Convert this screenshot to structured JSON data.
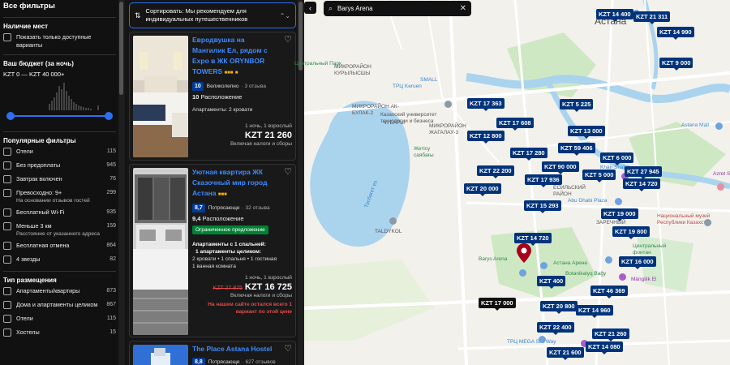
{
  "filters": {
    "title": "Все фильтры",
    "availability": {
      "title": "Наличие мест",
      "items": [
        {
          "label": "Показать только доступные варианты"
        }
      ]
    },
    "budget": {
      "title": "Ваш бюджет (за ночь)",
      "range": "KZT 0 — KZT 40 000+"
    },
    "popular": {
      "title": "Популярные фильтры",
      "items": [
        {
          "label": "Отели",
          "count": "115"
        },
        {
          "label": "Без предоплаты",
          "count": "945"
        },
        {
          "label": "Завтрак включен",
          "count": "76"
        },
        {
          "label": "Превосходно: 9+",
          "sub": "На основании отзывов гостей",
          "count": "299"
        },
        {
          "label": "Бесплатный Wi-Fi",
          "count": "935"
        },
        {
          "label": "Меньше 3 км",
          "sub": "Расстояние от указанного адреса",
          "count": "159"
        },
        {
          "label": "Бесплатная отмена",
          "count": "864"
        },
        {
          "label": "4 звезды",
          "count": "82"
        }
      ]
    },
    "type": {
      "title": "Тип размещения",
      "items": [
        {
          "label": "Апартаменты/квартиры",
          "count": "873"
        },
        {
          "label": "Дома и апартаменты целиком",
          "count": "867"
        },
        {
          "label": "Отели",
          "count": "115"
        },
        {
          "label": "Хостелы",
          "count": "15"
        }
      ]
    }
  },
  "sort": {
    "label": "Сортировать: Мы рекомендуем для индивидуальных путешественников"
  },
  "results": [
    {
      "title": "Евродвушка на Мангилик Ел, рядом с Expo в ЖК ORYNBOR TOWERS",
      "score": "10",
      "score_word": "Великолепно",
      "reviews": "· 3 отзыва",
      "location_score": "10",
      "location_label": "Расположение",
      "unit": "Апартаменты: 2 кровати",
      "nights": "1 ночь, 1 взрослый",
      "price": "KZT 21 260",
      "taxes": "Включая налоги и сборы"
    },
    {
      "title": "Уютная квартира ЖК Сказочный мир город Астана",
      "score": "8,7",
      "score_word": "Потрясающе",
      "reviews": "· 32 отзыва",
      "location_score": "9,4",
      "location_label": "Расположение",
      "deal": "Ограниченное предложение",
      "unit_head": "Апартаменты с 1 спальней:",
      "unit_bold": "1 апартаменты целиком:",
      "unit_line1": "2 кровати • 1 спальня • 1 гостиная",
      "unit_line2": "1 ванная комната",
      "nights": "1 ночь, 1 взрослый",
      "old_price": "KZT 27 875",
      "price": "KZT 16 725",
      "taxes": "Включая налоги и сборы",
      "warning": "На нашем сайте остался всего 1 вариант по этой цене"
    },
    {
      "title": "The Place Astana Hostel",
      "score": "8,8",
      "score_word": "Потрясающе",
      "reviews": "· 627 отзывов"
    }
  ],
  "map": {
    "search_value": "Barys Arena",
    "city": "Астана",
    "labels": [
      {
        "text": "Центральный Парк",
        "cls": "green"
      },
      {
        "text": "МИКРОРАЙОН КУРЫЛЫСШЫ",
        "cls": ""
      },
      {
        "text": "МИКРОРАЙОН АК-БУЛАК-2",
        "cls": ""
      },
      {
        "text": "ТРЦ Keruen",
        "cls": "blue"
      },
      {
        "text": "SMALL",
        "cls": "blue"
      },
      {
        "text": "Казахский университет технологии и бизнеса",
        "cls": ""
      },
      {
        "text": "ЧУБАРЫ",
        "cls": ""
      },
      {
        "text": "МИКРОРАЙОН ЖАГАЛАУ-3",
        "cls": ""
      },
      {
        "text": "Жетісу саябағы",
        "cls": "green"
      },
      {
        "text": "Astana Mall",
        "cls": "blue"
      },
      {
        "text": "Azret Sultan",
        "cls": "purple"
      },
      {
        "text": "Khan Shatyr",
        "cls": "blue"
      },
      {
        "text": "Abu Dhabi Plaza",
        "cls": "blue"
      },
      {
        "text": "ЕСИЛЬСКИЙ РАЙОН",
        "cls": ""
      },
      {
        "text": "ЗАРЕЧНЫЙ",
        "cls": ""
      },
      {
        "text": "Национальный музей Республики Казахстан",
        "cls": "red"
      },
      {
        "text": "Тасбөгет ез.",
        "cls": "blue"
      },
      {
        "text": "TALDYKOL",
        "cls": ""
      },
      {
        "text": "Центральный фонтан",
        "cls": "green"
      },
      {
        "text": "Barys Arena",
        "cls": "green"
      },
      {
        "text": "Астана Арена",
        "cls": "green"
      },
      {
        "text": "Botanikalyq Bağy",
        "cls": "green"
      },
      {
        "text": "Mängilik El",
        "cls": "purple"
      },
      {
        "text": "ТРЦ MEGA Silk Way",
        "cls": "blue"
      },
      {
        "text": "Мұражайы",
        "cls": "purple"
      }
    ],
    "prices": [
      {
        "text": "KZT 14 400",
        "dark": false
      },
      {
        "text": "KZT 21 311",
        "dark": false
      },
      {
        "text": "KZT 14 990",
        "dark": false
      },
      {
        "text": "KZT 9 000",
        "dark": false
      },
      {
        "text": "KZT 17 363",
        "dark": false
      },
      {
        "text": "KZT 5 225",
        "dark": false
      },
      {
        "text": "KZT 17 608",
        "dark": false
      },
      {
        "text": "KZT 13 000",
        "dark": false
      },
      {
        "text": "KZT 12 800",
        "dark": false
      },
      {
        "text": "KZT 59 406",
        "dark": false
      },
      {
        "text": "KZT 17 280",
        "dark": false
      },
      {
        "text": "KZT 6 000",
        "dark": false
      },
      {
        "text": "KZT 90 000",
        "dark": false
      },
      {
        "text": "KZT 22 200",
        "dark": false
      },
      {
        "text": "KZT 27 945",
        "dark": false
      },
      {
        "text": "KZT 5 000",
        "dark": false
      },
      {
        "text": "KZT 17 936",
        "dark": false
      },
      {
        "text": "KZT 14 720",
        "dark": false
      },
      {
        "text": "KZT 20 000",
        "dark": false
      },
      {
        "text": "KZT 15 293",
        "dark": false
      },
      {
        "text": "KZT 19 000",
        "dark": false
      },
      {
        "text": "KZT 19 800",
        "dark": false
      },
      {
        "text": "KZT 14 720",
        "dark": false
      },
      {
        "text": "KZT 16 000",
        "dark": false
      },
      {
        "text": "KZT 400",
        "dark": false
      },
      {
        "text": "KZT 46 369",
        "dark": false
      },
      {
        "text": "KZT 17 000",
        "dark": true
      },
      {
        "text": "KZT 20 800",
        "dark": false
      },
      {
        "text": "KZT 14 960",
        "dark": false
      },
      {
        "text": "KZT 22 400",
        "dark": false
      },
      {
        "text": "KZT 21 260",
        "dark": false
      },
      {
        "text": "KZT 14 080",
        "dark": false
      },
      {
        "text": "KZT 21 600",
        "dark": false
      }
    ]
  }
}
